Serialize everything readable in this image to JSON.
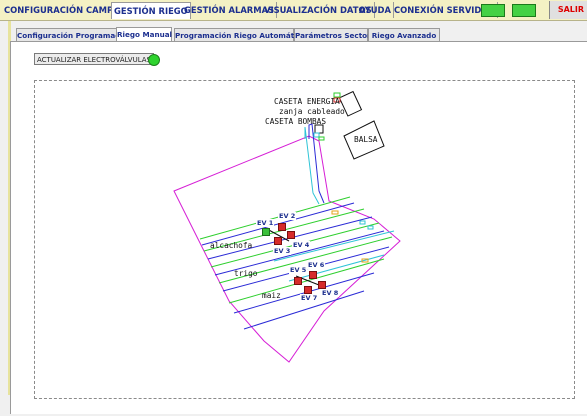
{
  "menu": {
    "items": [
      {
        "label": "CONFIGURACIÓN CAMPO",
        "active": false
      },
      {
        "label": "GESTIÓN RIEGO",
        "active": true
      },
      {
        "label": "GESTIÓN ALARMAS",
        "active": false
      },
      {
        "label": "VISUALIZACIÓN DATOS",
        "active": false
      },
      {
        "label": "AYUDA",
        "active": false
      },
      {
        "label": "CONEXIÓN SERVIDOR",
        "active": false
      }
    ],
    "exit_label": "SALIR"
  },
  "subtabs": [
    {
      "label": "Configuración Programador",
      "active": false
    },
    {
      "label": "Riego Manual",
      "active": true
    },
    {
      "label": "Programación Riego Automático",
      "active": false
    },
    {
      "label": "Parámetros Sector",
      "active": false
    },
    {
      "label": "Riego Avanzado",
      "active": false
    }
  ],
  "actions": {
    "update_valves_label": "ACTUALIZAR ELECTROVÁLVULAS"
  },
  "plan": {
    "caseta_energia": "CASETA ENERGIA",
    "zanja": "zanja cableado",
    "caseta_bombas": "CASETA BOMBAS",
    "balsa": "BALSA",
    "crop_alcachofa": "alcachofa",
    "crop_trigo": "trigo",
    "crop_maiz": "maiz",
    "valves": [
      {
        "label": "EV 1",
        "state": "on"
      },
      {
        "label": "EV 2",
        "state": "off"
      },
      {
        "label": "EV 3",
        "state": "off"
      },
      {
        "label": "EV 4",
        "state": "off"
      },
      {
        "label": "EV 5",
        "state": "off"
      },
      {
        "label": "EV 6",
        "state": "off"
      },
      {
        "label": "EV 7",
        "state": "off"
      },
      {
        "label": "EV 8",
        "state": "off"
      }
    ]
  },
  "colors": {
    "menu_text": "#1c2f8f",
    "led_green": "#44d144",
    "valve_red": "#d62b2b",
    "boundary_magenta": "#d61fd6",
    "line_blue": "#2b2bd6",
    "line_green": "#2ecf2e",
    "line_cyan": "#2ec4d6"
  }
}
